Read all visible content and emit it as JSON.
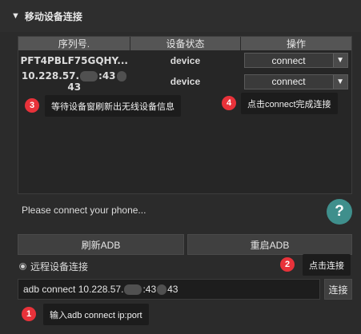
{
  "section_header": {
    "title": "移动设备连接"
  },
  "device_table": {
    "headers": [
      "序列号.",
      "设备状态",
      "操作"
    ],
    "rows": [
      {
        "serial": "PFT4PBLF75GQHY...",
        "status": "device",
        "action": "connect"
      },
      {
        "serial_parts": [
          "10.228.57.",
          ":43",
          "43"
        ],
        "status": "device",
        "action": "connect"
      }
    ]
  },
  "annotations": [
    {
      "number": "3",
      "text": "等待设备窗刷新出无线设备信息"
    },
    {
      "number": "4",
      "text": "点击connect完成连接"
    },
    {
      "number": "2",
      "text": "点击连接"
    },
    {
      "number": "1",
      "text": "输入adb connect ip:port"
    }
  ],
  "status_message": "Please connect your phone...",
  "help_button": {
    "label": "?"
  },
  "buttons": {
    "refresh": "刷新ADB",
    "restart": "重启ADB",
    "connect": "连接"
  },
  "remote": {
    "label": "远程设备连接"
  },
  "command_input": {
    "parts": [
      "adb connect 10.228.57.",
      ":43",
      "43"
    ]
  },
  "colors": {
    "badge": "#e8323a",
    "help": "#3f8f8c",
    "background": "#2b2b2b"
  }
}
